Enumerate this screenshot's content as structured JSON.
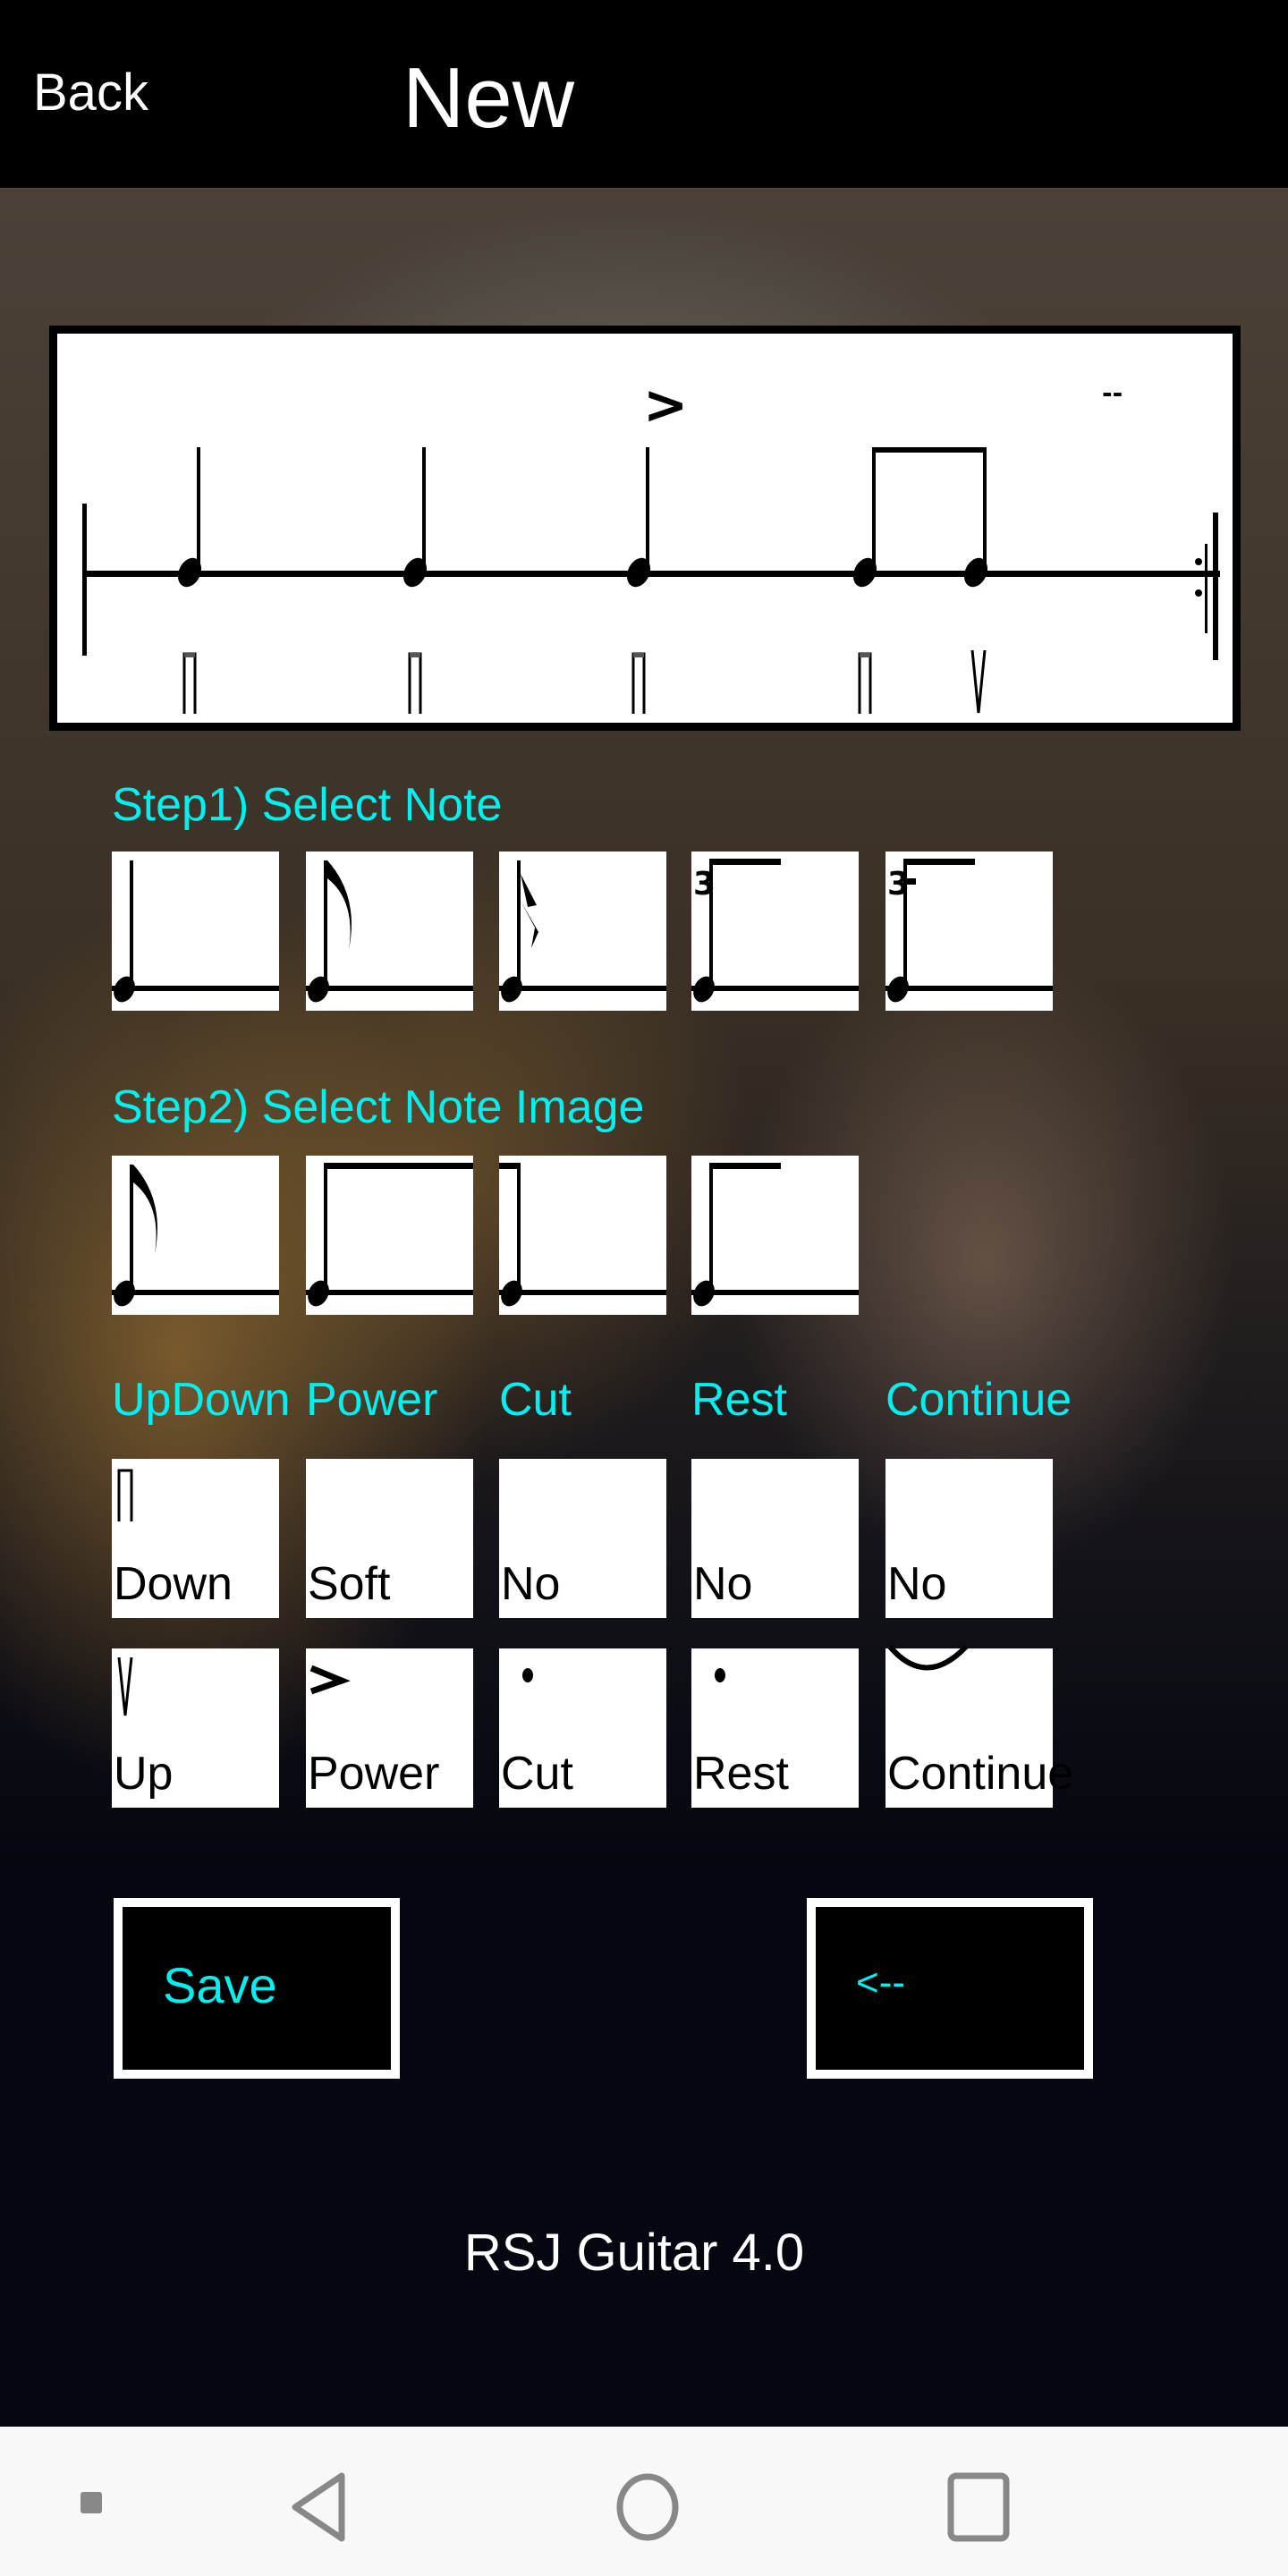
{
  "header": {
    "back_label": "Back",
    "title": "New"
  },
  "score": {
    "accent_symbol": ">",
    "marker": "--",
    "strokes": [
      "Down",
      "Down",
      "Down",
      "Down",
      "Up"
    ]
  },
  "step1": {
    "label": "Step1) Select Note",
    "notes": [
      "quarter-note",
      "eighth-note",
      "sixteenth-note",
      "triplet-eighth",
      "triplet-sixteenth"
    ],
    "triplet_mark": "3"
  },
  "step2": {
    "label": "Step2) Select Note Image",
    "images": [
      "eighth-flag",
      "beam-start",
      "beam-end",
      "beam-start-short"
    ]
  },
  "options": {
    "headers": [
      "UpDown",
      "Power",
      "Cut",
      "Rest",
      "Continue"
    ],
    "current": [
      "Down",
      "Soft",
      "No",
      "No",
      "No"
    ],
    "choices": [
      "Up",
      "Power",
      "Cut",
      "Rest",
      "Continue"
    ]
  },
  "buttons": {
    "save": "Save",
    "backspace": "<--"
  },
  "footer": {
    "version": "RSJ Guitar 4.0"
  },
  "colors": {
    "accent": "#00f0f0",
    "header_bg": "#000000",
    "tile_bg": "#ffffff"
  }
}
